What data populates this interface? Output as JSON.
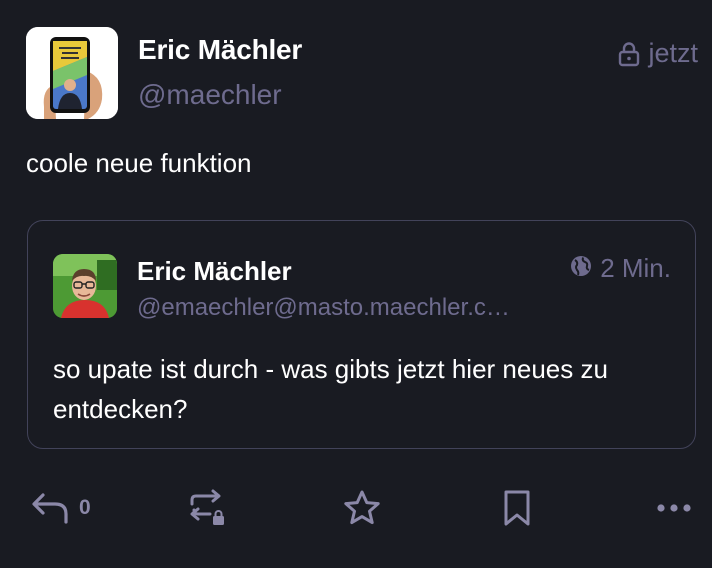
{
  "post": {
    "author": {
      "display_name": "Eric Mächler",
      "handle": "@maechler"
    },
    "visibility_icon": "lock-icon",
    "time": "jetzt",
    "content": "coole neue funktion"
  },
  "quoted_post": {
    "author": {
      "display_name": "Eric Mächler",
      "handle": "@emaechler@masto.maechler.c…"
    },
    "visibility_icon": "globe-icon",
    "time": "2 Min.",
    "content": "so upate ist durch - was gibts jetzt hier neues zu entdecken?"
  },
  "actions": {
    "reply_icon": "reply-icon",
    "reply_count": "0",
    "boost_icon": "boost-locked-icon",
    "favourite_icon": "star-icon",
    "bookmark_icon": "bookmark-icon",
    "more_icon": "more-icon"
  },
  "colors": {
    "background": "#191b22",
    "muted": "#6e6b8e",
    "border": "#42435a"
  }
}
